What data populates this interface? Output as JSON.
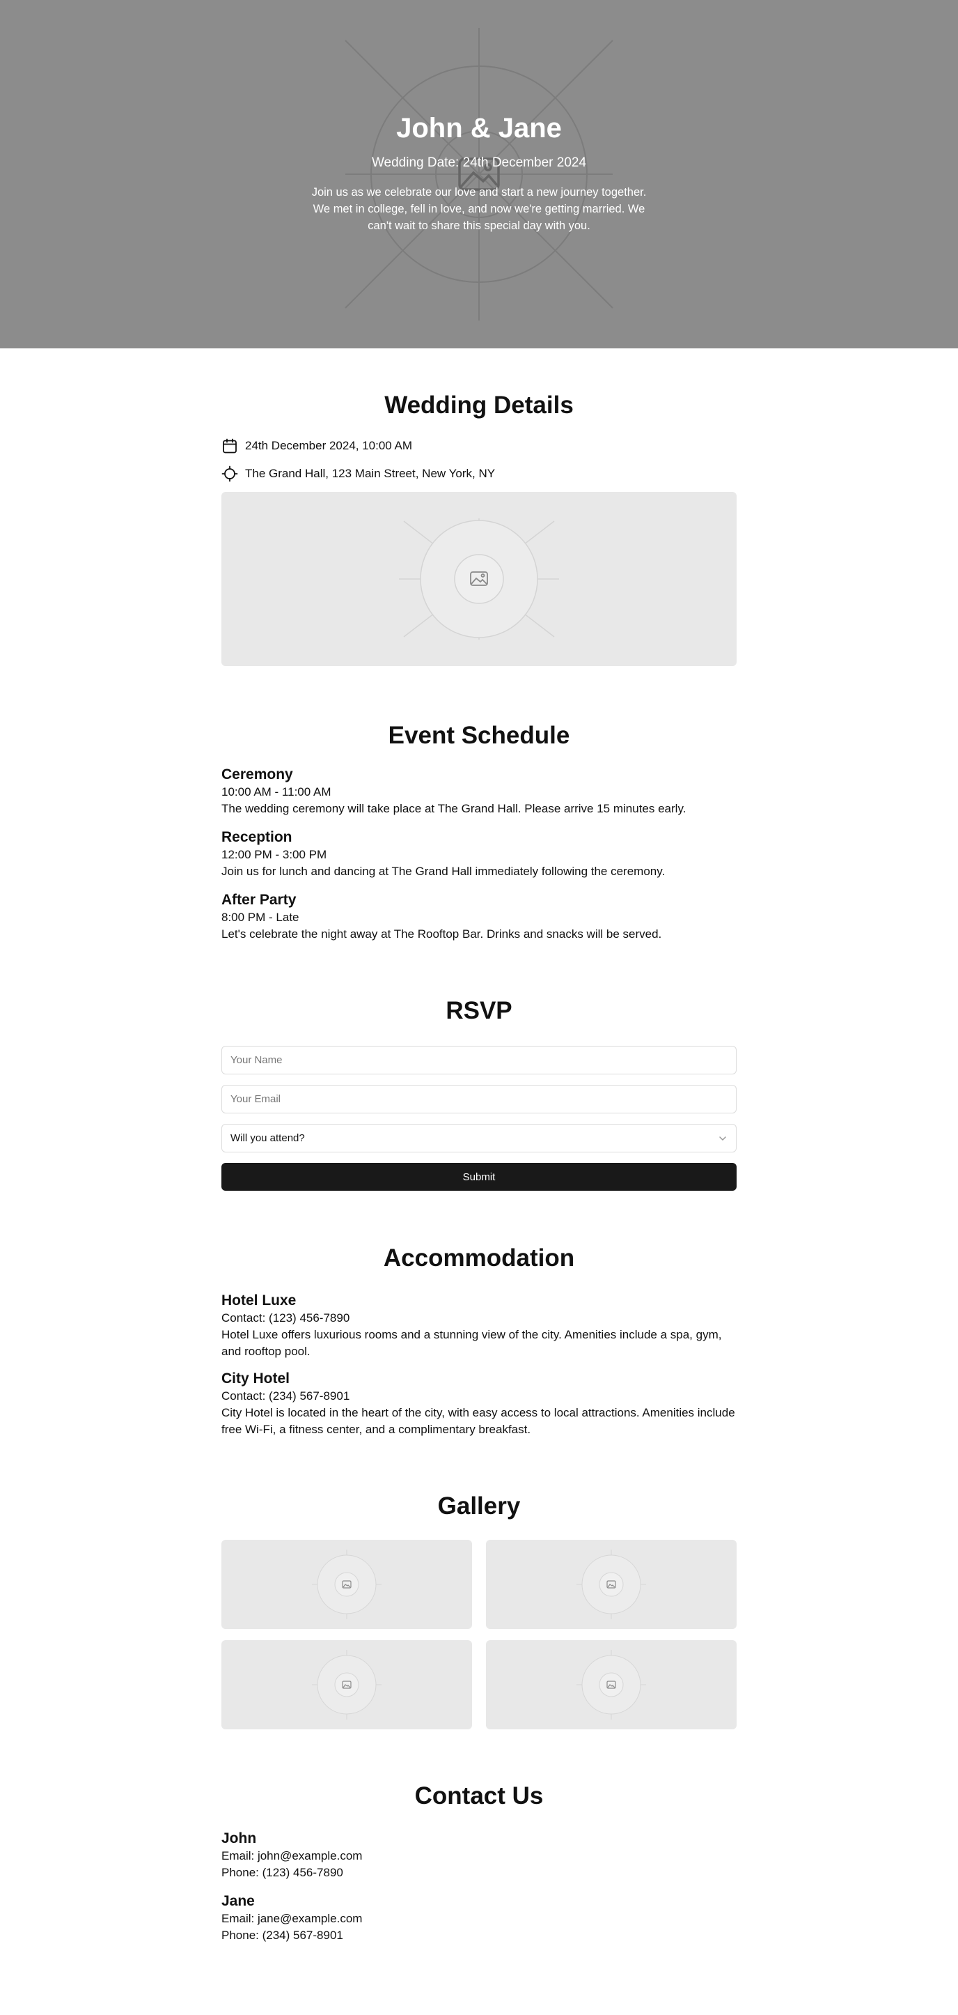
{
  "hero": {
    "title": "John & Jane",
    "date": "Wedding Date: 24th December 2024",
    "text": "Join us as we celebrate our love and start a new journey together. We met in college, fell in love, and now we're getting married. We can't wait to share this special day with you.",
    "background_icon": "image-placeholder-icon"
  },
  "details": {
    "title": "Wedding Details",
    "datetime": "24th December 2024, 10:00 AM",
    "datetime_icon": "calendar-icon",
    "location": "The Grand Hall, 123 Main Street, New York, NY",
    "location_icon": "location-crosshair-icon",
    "image_icon": "image-placeholder-icon"
  },
  "schedule": {
    "title": "Event Schedule",
    "events": [
      {
        "name": "Ceremony",
        "time": "10:00 AM - 11:00 AM",
        "description": "The wedding ceremony will take place at The Grand Hall. Please arrive 15 minutes early."
      },
      {
        "name": "Reception",
        "time": "12:00 PM - 3:00 PM",
        "description": "Join us for lunch and dancing at The Grand Hall immediately following the ceremony."
      },
      {
        "name": "After Party",
        "time": "8:00 PM - Late",
        "description": "Let's celebrate the night away at The Rooftop Bar. Drinks and snacks will be served."
      }
    ]
  },
  "rsvp": {
    "title": "RSVP",
    "name_placeholder": "Your Name",
    "name_value": "",
    "email_placeholder": "Your Email",
    "email_value": "",
    "attend_selected": "Will you attend?",
    "attend_icon": "chevron-down-icon",
    "submit_label": "Submit"
  },
  "accommodation": {
    "title": "Accommodation",
    "hotels": [
      {
        "name": "Hotel Luxe",
        "contact": "Contact: (123) 456-7890",
        "description": "Hotel Luxe offers luxurious rooms and a stunning view of the city. Amenities include a spa, gym, and rooftop pool."
      },
      {
        "name": "City Hotel",
        "contact": "Contact: (234) 567-8901",
        "description": "City Hotel is located in the heart of the city, with easy access to local attractions. Amenities include free Wi-Fi, a fitness center, and a complimentary breakfast."
      }
    ]
  },
  "gallery": {
    "title": "Gallery",
    "image_icon": "image-placeholder-icon",
    "image_count": 4
  },
  "contact": {
    "title": "Contact Us",
    "people": [
      {
        "name": "John",
        "email": "Email: john@example.com",
        "phone": "Phone: (123) 456-7890"
      },
      {
        "name": "Jane",
        "email": "Email: jane@example.com",
        "phone": "Phone: (234) 567-8901"
      }
    ]
  },
  "colors": {
    "hero_bg": "#8c8c8c",
    "placeholder_bg": "#e8e8e8",
    "button_bg": "#191919",
    "text": "#111111"
  }
}
